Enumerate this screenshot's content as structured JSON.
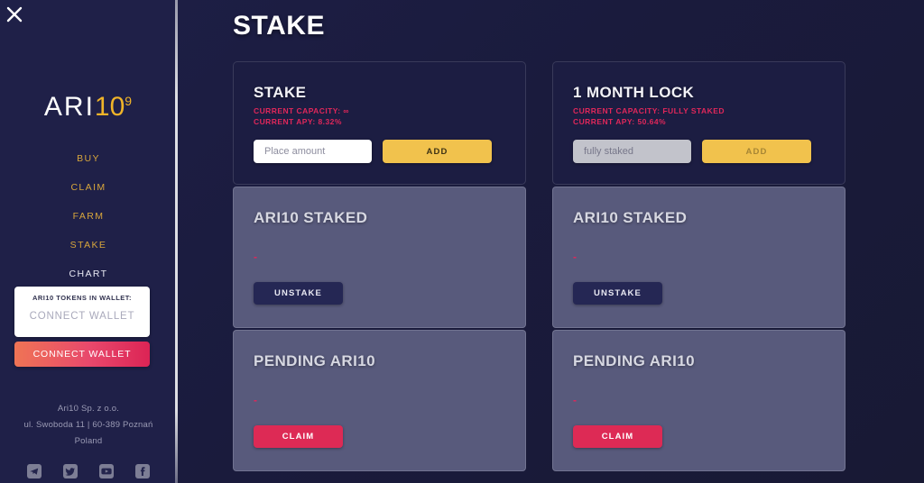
{
  "sidebar": {
    "close_icon": "close-icon",
    "logo": {
      "part1": "ARI",
      "part2": "10",
      "superscript": "9"
    },
    "nav": [
      {
        "label": "BUY",
        "active": false
      },
      {
        "label": "CLAIM",
        "active": false
      },
      {
        "label": "FARM",
        "active": false
      },
      {
        "label": "STAKE",
        "active": false
      },
      {
        "label": "CHART",
        "active": true
      }
    ],
    "wallet_box": {
      "label": "ARI10 TOKENS IN WALLET:",
      "value": "CONNECT WALLET"
    },
    "connect_button": "CONNECT WALLET",
    "address": [
      "Ari10 Sp. z o.o.",
      "ul. Swoboda 11 | 60-389 Poznań",
      "Poland"
    ],
    "socials": [
      {
        "name": "telegram-icon"
      },
      {
        "name": "twitter-icon"
      },
      {
        "name": "youtube-icon"
      },
      {
        "name": "facebook-icon"
      }
    ]
  },
  "main": {
    "page_title": "STAKE",
    "columns": [
      {
        "id": "stake",
        "title": "STAKE",
        "capacity": "CURRENT CAPACITY: ∞",
        "apy": "CURRENT APY: 8.32%",
        "input_placeholder": "Place amount",
        "input_value": "",
        "input_disabled": false,
        "add_label": "ADD",
        "add_disabled": false,
        "staked": {
          "title": "ARI10 STAKED",
          "value": "-",
          "button": "UNSTAKE"
        },
        "pending": {
          "title": "PENDING ARI10",
          "value": "-",
          "button": "CLAIM"
        }
      },
      {
        "id": "one-month-lock",
        "title": "1 MONTH LOCK",
        "capacity": "CURRENT CAPACITY: FULLY STAKED",
        "apy": "CURRENT APY: 50.64%",
        "input_placeholder": "fully staked",
        "input_value": "",
        "input_disabled": true,
        "add_label": "ADD",
        "add_disabled": true,
        "staked": {
          "title": "ARI10 STAKED",
          "value": "-",
          "button": "UNSTAKE"
        },
        "pending": {
          "title": "PENDING ARI10",
          "value": "-",
          "button": "CLAIM"
        }
      }
    ]
  },
  "colors": {
    "background": "#1a1b3f",
    "sidebar": "#1f2048",
    "accent_gold": "#f1c24d",
    "accent_nav": "#d8a63c",
    "accent_red": "#e0275a",
    "panel": "#585a7c",
    "card": "#1c1d42",
    "claim_button": "#dd2a55",
    "unstake_button": "#252754"
  }
}
